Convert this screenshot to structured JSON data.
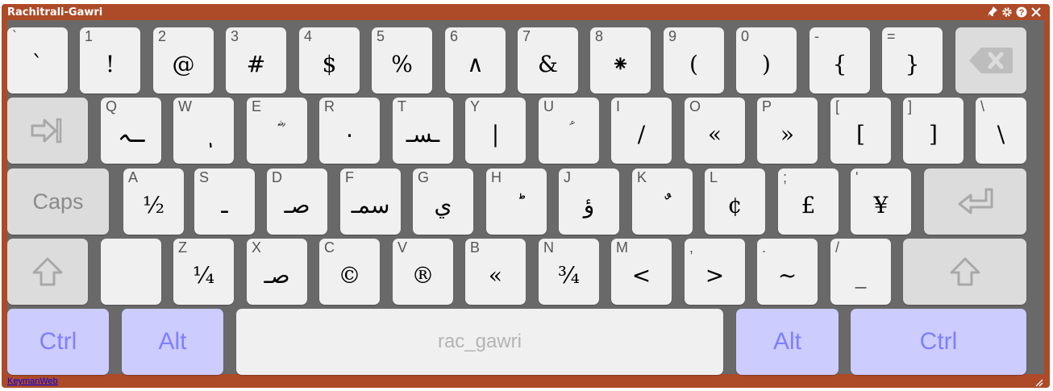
{
  "window": {
    "title": "Rachitrali-Gawri",
    "controls": [
      {
        "name": "pin-icon",
        "glyph": "📌"
      },
      {
        "name": "gear-icon",
        "glyph": "⚙"
      },
      {
        "name": "help-icon",
        "glyph": "?"
      },
      {
        "name": "close-icon",
        "glyph": "✕"
      }
    ]
  },
  "rows": [
    [
      {
        "cap": "`",
        "label": "`"
      },
      {
        "cap": "1",
        "label": "!"
      },
      {
        "cap": "2",
        "label": "@"
      },
      {
        "cap": "3",
        "label": "#"
      },
      {
        "cap": "4",
        "label": "$"
      },
      {
        "cap": "5",
        "label": "%"
      },
      {
        "cap": "6",
        "label": "∧"
      },
      {
        "cap": "7",
        "label": "&"
      },
      {
        "cap": "8",
        "label": "⁕"
      },
      {
        "cap": "9",
        "label": "("
      },
      {
        "cap": "0",
        "label": ")"
      },
      {
        "cap": "-",
        "label": "{"
      },
      {
        "cap": "=",
        "label": "}"
      },
      {
        "special": "backspace",
        "icon": "backspace-icon"
      }
    ],
    [
      {
        "special": "tab",
        "icon": "tab-icon"
      },
      {
        "cap": "Q",
        "label": "ـہ"
      },
      {
        "cap": "W",
        "label": "ٖ"
      },
      {
        "cap": "E",
        "label": "ؓ"
      },
      {
        "cap": "R",
        "label": "٠"
      },
      {
        "cap": "T",
        "label": "ـسـ"
      },
      {
        "cap": "Y",
        "label": "|"
      },
      {
        "cap": "U",
        "label": "ؑ"
      },
      {
        "cap": "I",
        "label": "/"
      },
      {
        "cap": "O",
        "label": "«"
      },
      {
        "cap": "P",
        "label": "»"
      },
      {
        "cap": "[",
        "label": "["
      },
      {
        "cap": "]",
        "label": "]"
      },
      {
        "cap": "\\",
        "label": "\\"
      }
    ],
    [
      {
        "special": "caps",
        "text": "Caps"
      },
      {
        "cap": "A",
        "label": "½"
      },
      {
        "cap": "S",
        "label": "ـ"
      },
      {
        "cap": "D",
        "label": "صـ"
      },
      {
        "cap": "F",
        "label": "سمـ"
      },
      {
        "cap": "G",
        "label": "ي"
      },
      {
        "cap": "H",
        "label": "ؕ"
      },
      {
        "cap": "J",
        "label": "ؤ"
      },
      {
        "cap": "K",
        "label": "ٌ"
      },
      {
        "cap": "L",
        "label": "¢"
      },
      {
        "cap": ";",
        "label": "£"
      },
      {
        "cap": "'",
        "label": "¥"
      },
      {
        "special": "enter",
        "icon": "enter-icon"
      }
    ],
    [
      {
        "special": "shift",
        "icon": "shift-icon"
      },
      {
        "cap": "",
        "label": ""
      },
      {
        "cap": "Z",
        "label": "¼"
      },
      {
        "cap": "X",
        "label": "صـ"
      },
      {
        "cap": "C",
        "label": "©"
      },
      {
        "cap": "V",
        "label": "®"
      },
      {
        "cap": "B",
        "label": "«"
      },
      {
        "cap": "N",
        "label": "¾"
      },
      {
        "cap": "M",
        "label": "<"
      },
      {
        "cap": ",",
        "label": ">"
      },
      {
        "cap": ".",
        "label": "~"
      },
      {
        "cap": "/",
        "label": "_"
      },
      {
        "special": "shift",
        "icon": "shift-icon"
      }
    ],
    [
      {
        "special": "ctrl",
        "text": "Ctrl"
      },
      {
        "special": "alt",
        "text": "Alt"
      },
      {
        "special": "space",
        "text": "rac_gawri"
      },
      {
        "special": "alt",
        "text": "Alt"
      },
      {
        "special": "ctrl",
        "text": "Ctrl"
      }
    ]
  ],
  "footer": {
    "link": "KeymanWeb"
  },
  "colors": {
    "frame": "#ad4a28",
    "key_area": "#696969",
    "key": "#f0f0f0",
    "special_key": "#dcdcdc",
    "modifier_key": "#ccccff"
  }
}
